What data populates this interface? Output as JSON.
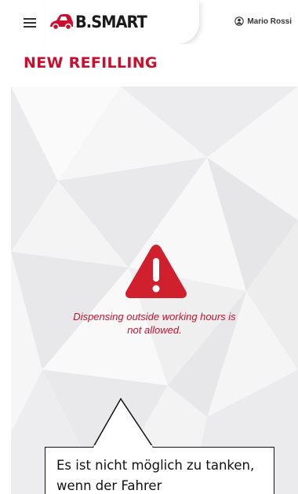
{
  "header": {
    "brand": "B.SMART",
    "user_name": "Mario Rossi"
  },
  "page": {
    "title": "NEW REFILLING"
  },
  "message": {
    "error": "Dispensing outside working hours is not allowed."
  },
  "callout": {
    "text": "Es ist nicht möglich zu tanken, wenn der Fahrer"
  },
  "colors": {
    "accent": "#c8102e",
    "background": "#f2f2f3"
  },
  "icons": [
    "menu-icon",
    "car-logo-icon",
    "user-circle-icon",
    "warning-triangle-icon"
  ]
}
